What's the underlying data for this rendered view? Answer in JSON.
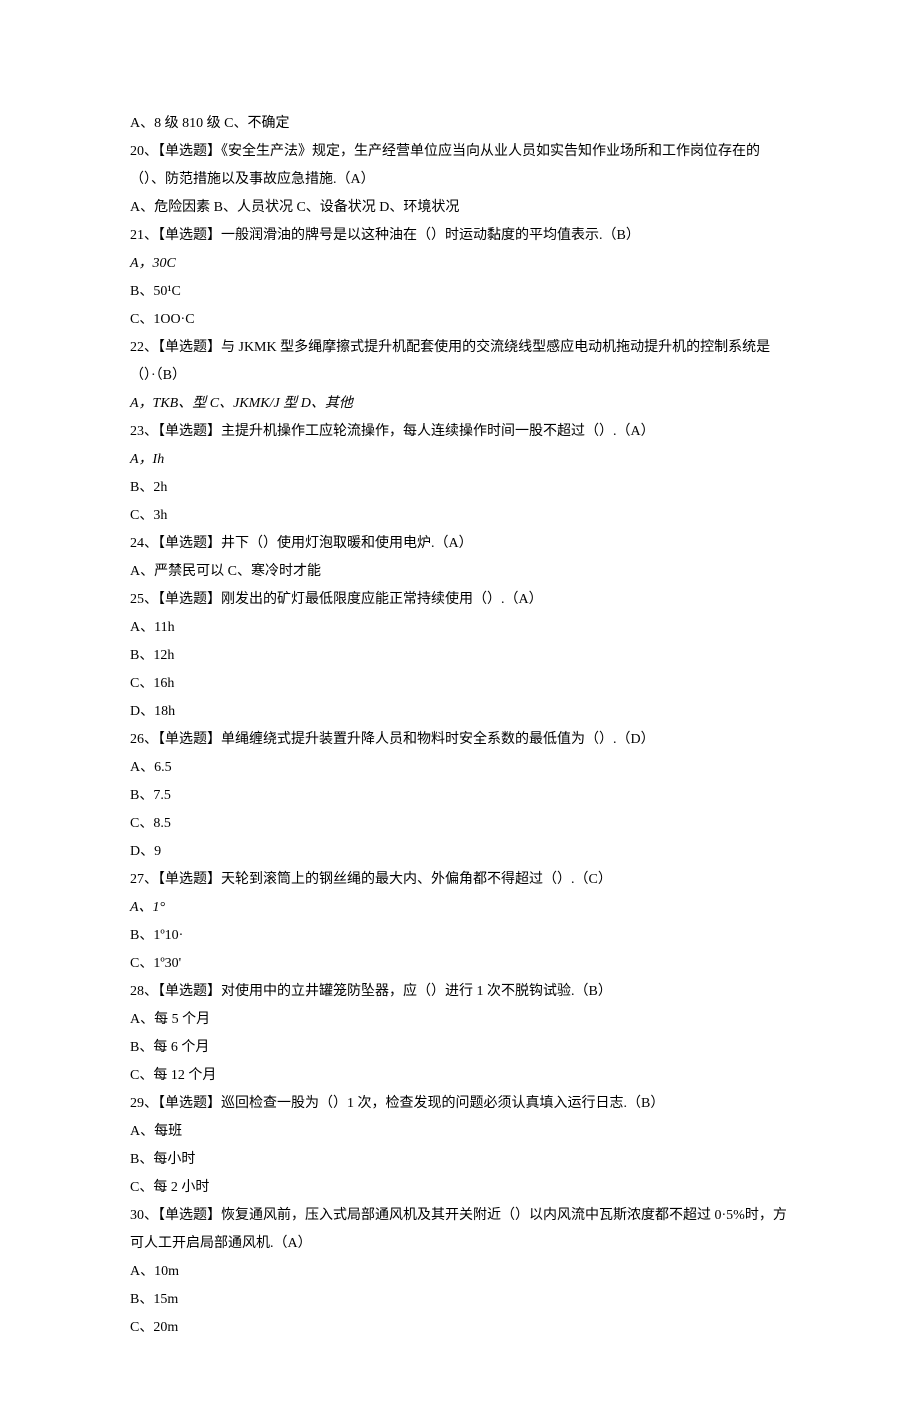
{
  "lines": [
    {
      "text": "A、8 级 810 级 C、不确定"
    },
    {
      "text": "20、【单选题】《安全生产法》规定，生产经营单位应当向从业人员如实告知作业场所和工作岗位存在的（）、防范措施以及事故应急措施.（A）"
    },
    {
      "text": "A、危险因素 B、人员状况 C、设备状况 D、环境状况"
    },
    {
      "text": "21、【单选题】一般润滑油的牌号是以这种油在（）时运动黏度的平均值表示.（B）"
    },
    {
      "text": "A，30C",
      "italic": true
    },
    {
      "text": "B、50¹C"
    },
    {
      "text": "C、1OO·C"
    },
    {
      "text": "22、【单选题】与 JKMK 型多绳摩擦式提升机配套使用的交流绕线型感应电动机拖动提升机的控制系统是（）·（B）"
    },
    {
      "text": "A，TKB、型 C、JKMK/J 型 D、其他",
      "italic": true
    },
    {
      "text": "23、【单选题】主提升机操作工应轮流操作，每人连续操作时间一股不超过（）.（A）"
    },
    {
      "text": "A，Ih",
      "italic": true
    },
    {
      "text": "B、2h"
    },
    {
      "text": "C、3h"
    },
    {
      "text": "24、【单选题】井下（）使用灯泡取暖和使用电炉.（A）"
    },
    {
      "text": "A、严禁民可以 C、寒冷时才能"
    },
    {
      "text": "25、【单选题】刚发出的矿灯最低限度应能正常持续使用（）.（A）"
    },
    {
      "text": "A、11h"
    },
    {
      "text": "B、12h"
    },
    {
      "text": "C、16h"
    },
    {
      "text": "D、18h"
    },
    {
      "text": "26、【单选题】单绳缠绕式提升装置升降人员和物料时安全系数的最低值为（）.（D）"
    },
    {
      "text": "A、6.5"
    },
    {
      "text": "B、7.5"
    },
    {
      "text": "C、8.5"
    },
    {
      "text": "D、9"
    },
    {
      "text": "27、【单选题】天轮到滚筒上的钢丝绳的最大内、外偏角都不得超过（）.（C）"
    },
    {
      "text": "A、1°",
      "italic": true
    },
    {
      "text": "B、1º10·"
    },
    {
      "text": "C、1º30'"
    },
    {
      "text": "28、【单选题】对使用中的立井罐笼防坠器，应（）进行 1 次不脱钩试验.（B）"
    },
    {
      "text": "A、每 5 个月"
    },
    {
      "text": "B、每 6 个月"
    },
    {
      "text": "C、每 12 个月"
    },
    {
      "text": "29、【单选题】巡回检查一股为（）1 次，检查发现的问题必须认真填入运行日志.（B）"
    },
    {
      "text": "A、每班"
    },
    {
      "text": "B、每小时"
    },
    {
      "text": "C、每 2 小时"
    },
    {
      "text": "30、【单选题】恢复通风前，压入式局部通风机及其开关附近（）以内风流中瓦斯浓度都不超过 0·5%时，方可人工开启局部通风机.（A）"
    },
    {
      "text": "A、10m"
    },
    {
      "text": "B、15m"
    },
    {
      "text": "C、20m"
    }
  ]
}
